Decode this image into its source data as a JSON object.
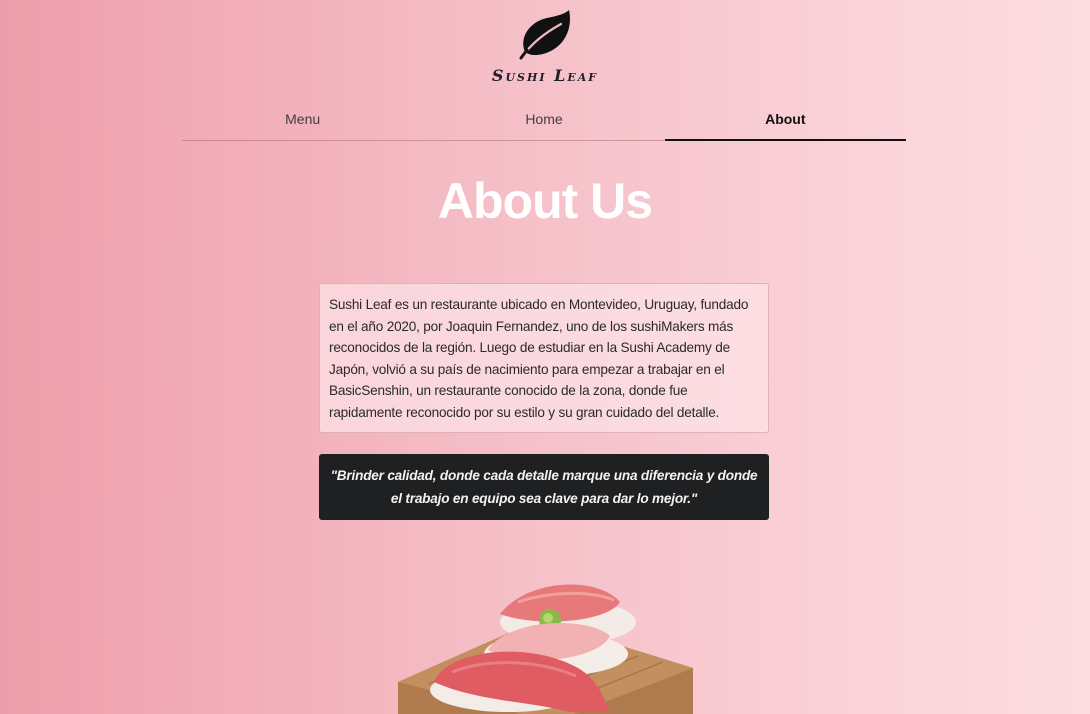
{
  "header": {
    "logo_icon": "leaf-icon",
    "brand_name": "Sushi Leaf"
  },
  "nav": {
    "items": [
      {
        "label": "Menu",
        "active": false
      },
      {
        "label": "Home",
        "active": false
      },
      {
        "label": "About",
        "active": true
      }
    ]
  },
  "main": {
    "title": "About Us",
    "about_text": "Sushi Leaf es un restaurante ubicado en Montevideo, Uruguay, fundado en el año 2020, por Joaquin Fernandez, uno de los sushiMakers más reconocidos de la región. Luego de estudiar en la Sushi Academy de Japón, volvió a su país de nacimiento para empezar a trabajar en el BasicSenshin, un restaurante conocido de la zona, donde fue rapidamente reconocido por su estilo y su gran cuidado del detalle.",
    "quote": "\"Brinder calidad, donde cada detalle marque una diferencia y donde el trabajo en equipo sea clave para dar lo mejor.\""
  },
  "colors": {
    "background_left": "#ee9eab",
    "background_right": "#fddde2",
    "title": "#ffffff",
    "quote_background": "#1f2022",
    "leaf": "#111111"
  }
}
